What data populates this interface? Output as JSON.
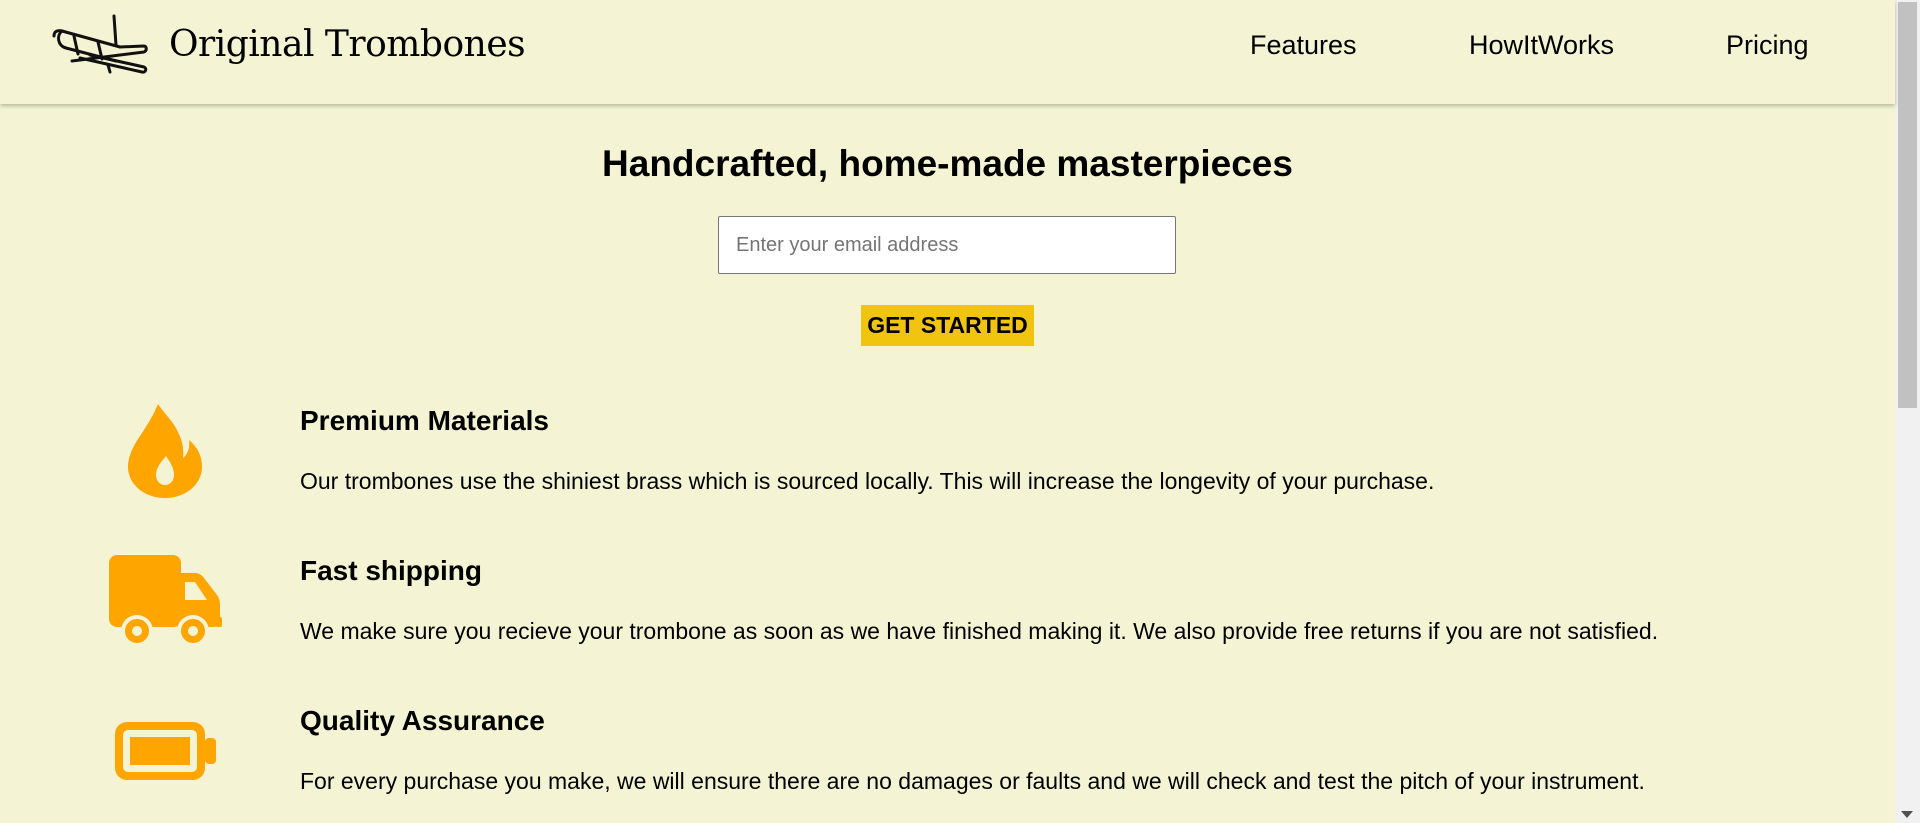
{
  "header": {
    "brand": "Original Trombones",
    "logo_icon": "trombone-icon",
    "nav": [
      "Features",
      "HowItWorks",
      "Pricing"
    ]
  },
  "hero": {
    "title": "Handcrafted, home-made masterpieces",
    "email_placeholder": "Enter your email address",
    "email_value": "",
    "cta_label": "GET STARTED"
  },
  "features": [
    {
      "icon": "fire-icon",
      "title": "Premium Materials",
      "text": "Our trombones use the shiniest brass which is sourced locally. This will increase the longevity of your purchase."
    },
    {
      "icon": "truck-icon",
      "title": "Fast shipping",
      "text": "We make sure you recieve your trombone as soon as we have finished making it. We also provide free returns if you are not satisfied."
    },
    {
      "icon": "battery-icon",
      "title": "Quality Assurance",
      "text": "For every purchase you make, we will ensure there are no damages or faults and we will check and test the pitch of your instrument."
    }
  ],
  "colors": {
    "background": "#f4f4d4",
    "accent_button": "#f1c40f",
    "icon_orange": "#ffa500"
  }
}
